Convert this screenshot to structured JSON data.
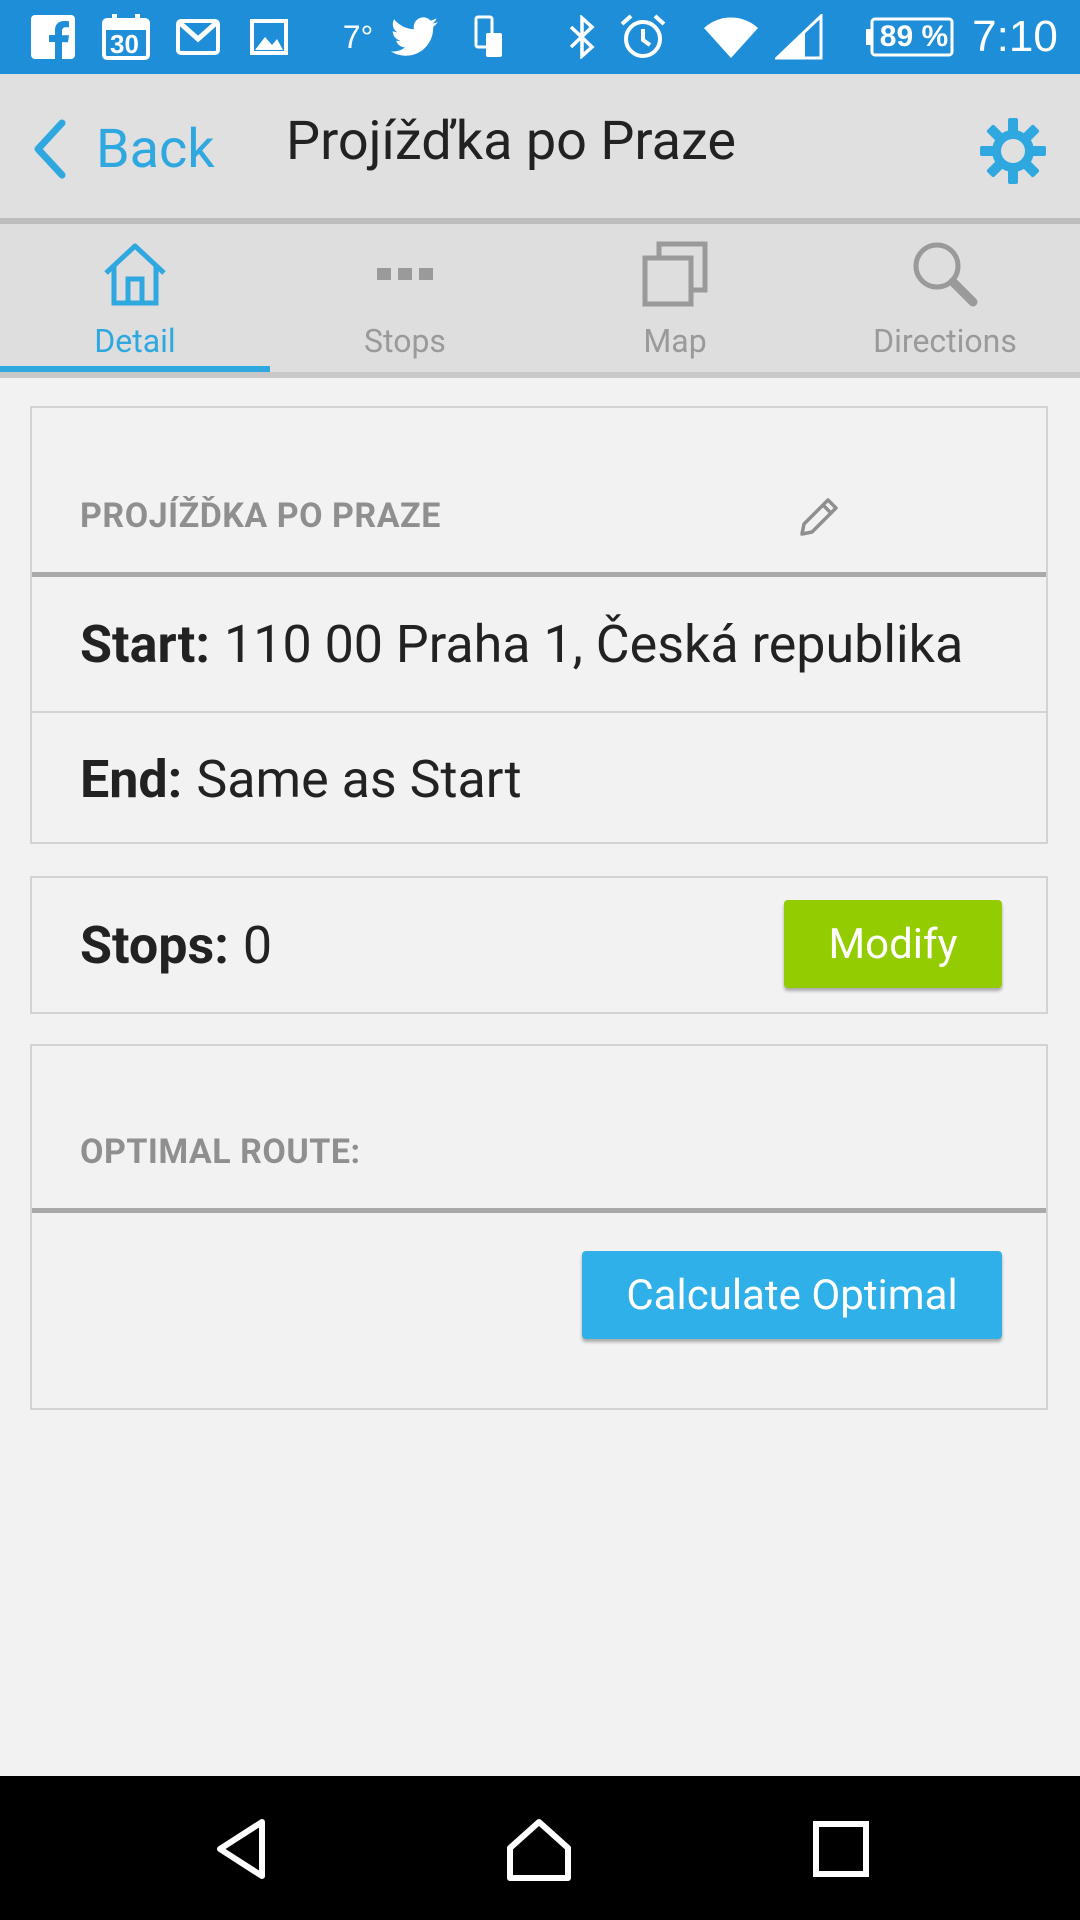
{
  "status_bar": {
    "temperature": "7°",
    "battery": "89 %",
    "time": "7:10",
    "calendar_day": "30",
    "icons": [
      "facebook-icon",
      "calendar-icon",
      "gmail-icon",
      "gallery-icon",
      "twitter-icon",
      "phone-icon",
      "bluetooth-icon",
      "alarm-icon",
      "wifi-icon",
      "signal-icon",
      "battery-icon"
    ]
  },
  "header": {
    "back_label": "Back",
    "title": "Projížďka po Praze",
    "settings_icon": "gear-icon"
  },
  "tabs": [
    {
      "label": "Detail",
      "icon": "home-icon",
      "active": true
    },
    {
      "label": "Stops",
      "icon": "dots-icon",
      "active": false
    },
    {
      "label": "Map",
      "icon": "layers-icon",
      "active": false
    },
    {
      "label": "Directions",
      "icon": "search-icon",
      "active": false
    }
  ],
  "route_card": {
    "heading": "PROJÍŽĎKA PO PRAZE",
    "start_label": "Start:",
    "start_value": "110 00 Praha 1, Česká republika",
    "end_label": "End:",
    "end_value": "Same as Start"
  },
  "stops_card": {
    "label": "Stops:",
    "value": "0",
    "modify_label": "Modify"
  },
  "optimal_card": {
    "heading": "OPTIMAL ROUTE:",
    "calculate_label": "Calculate Optimal"
  },
  "colors": {
    "status_bar": "#1e8ed8",
    "accent": "#2fa8e0",
    "modify_button": "#93cc00",
    "calculate_button": "#30b0e8"
  }
}
